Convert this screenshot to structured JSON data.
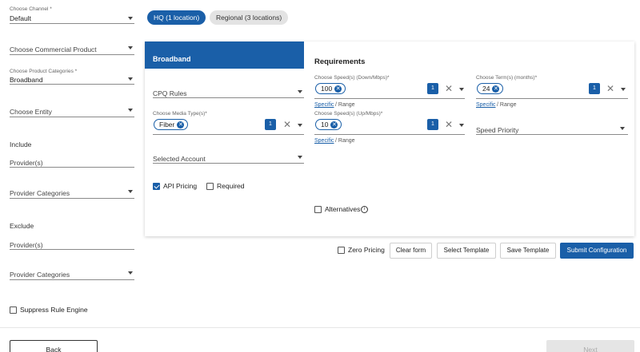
{
  "left": {
    "channel": {
      "label": "Choose Channel *",
      "value": "Default"
    },
    "commercial_product": {
      "placeholder": "Choose Commercial Product"
    },
    "product_categories": {
      "label": "Choose Product Categories *",
      "value": "Broadband"
    },
    "entity": {
      "placeholder": "Choose Entity"
    },
    "include_heading": "Include",
    "include_providers": "Provider(s)",
    "include_provider_categories": "Provider Categories",
    "exclude_heading": "Exclude",
    "exclude_providers": "Provider(s)",
    "exclude_provider_categories": "Provider Categories",
    "suppress_rule_engine": {
      "label": "Suppress Rule Engine",
      "checked": false
    }
  },
  "location_tabs": [
    {
      "label": "HQ (1 location)",
      "active": true
    },
    {
      "label": "Regional (3 locations)",
      "active": false
    }
  ],
  "card": {
    "tab_label": "Broadband",
    "cpq_rules": {
      "placeholder": "CPQ Rules"
    },
    "media_type": {
      "label": "Choose Media Type(s)*",
      "chip": "Fiber",
      "count": "1"
    },
    "selected_account": {
      "placeholder": "Selected Account"
    },
    "api_pricing": {
      "label": "API Pricing",
      "checked": true
    },
    "required": {
      "label": "Required",
      "checked": false
    },
    "requirements": {
      "title": "Requirements",
      "speed_down": {
        "label": "Choose Speed(s) (Down/Mbps)*",
        "chip": "100",
        "count": "1",
        "link": "Specific",
        "sep": "/ Range"
      },
      "term": {
        "label": "Choose Term(s) (months)*",
        "chip": "24",
        "count": "1",
        "link": "Specific",
        "sep": "/ Range"
      },
      "speed_up": {
        "label": "Choose Speed(s) (Up/Mbps)*",
        "chip": "10",
        "count": "1",
        "link": "Specific",
        "sep": "/ Range"
      },
      "speed_priority": {
        "placeholder": "Speed Priority"
      },
      "alternatives": {
        "label": "Alternatives",
        "checked": false
      }
    }
  },
  "actions": {
    "zero_pricing": {
      "label": "Zero Pricing",
      "checked": false
    },
    "clear_form": "Clear form",
    "select_template": "Select Template",
    "save_template": "Save Template",
    "submit": "Submit Configuration"
  },
  "footer": {
    "back": "Back",
    "next": "Next"
  },
  "colors": {
    "accent": "#1a5fa8",
    "disabled": "#e5e5e5"
  },
  "icons": {
    "dropdown": "chevron-down-icon",
    "clear": "close-icon",
    "chip_remove": "close-circle-icon",
    "info": "info-icon"
  }
}
